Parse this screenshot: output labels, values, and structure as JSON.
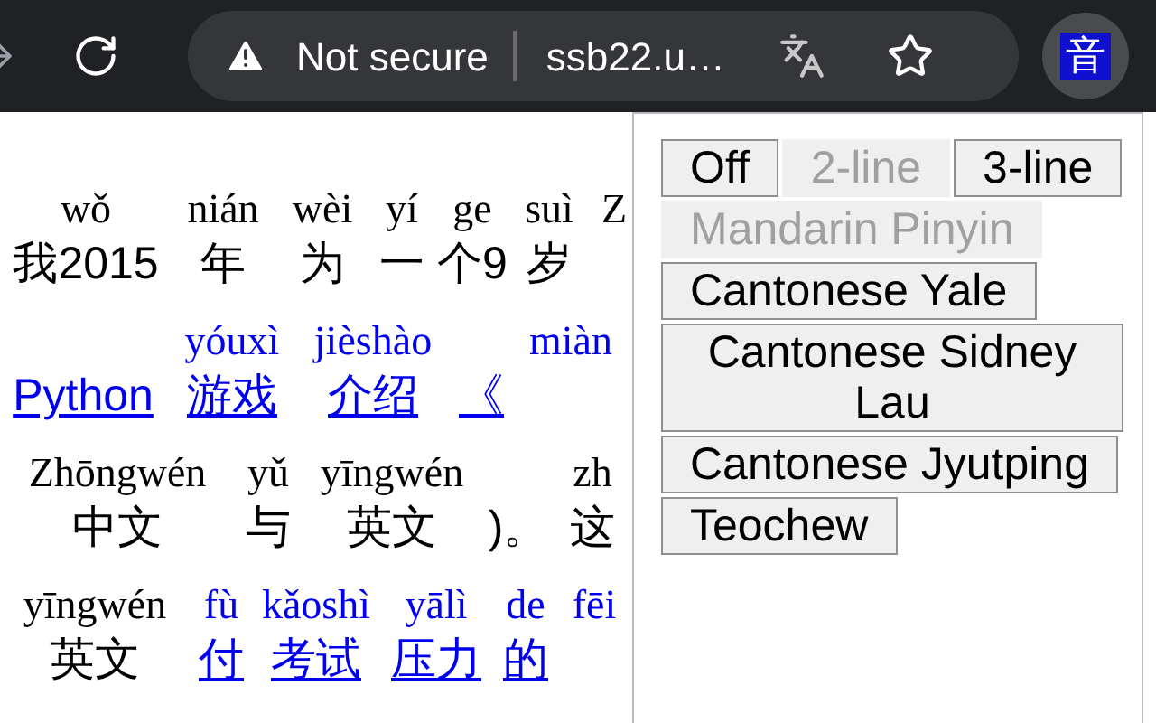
{
  "toolbar": {
    "security_label": "Not secure",
    "url": "ssb22.u…",
    "extension_label": "音"
  },
  "page": {
    "rows": [
      {
        "segments": [
          {
            "pinyin": "wǒ",
            "hanzi": "我2015",
            "link": false
          },
          {
            "pinyin": "nián",
            "hanzi": "年",
            "link": false
          },
          {
            "pinyin": "wèi",
            "hanzi": "为",
            "link": false
          },
          {
            "pinyin": "yí",
            "hanzi": "一",
            "link": false
          },
          {
            "pinyin": "ge",
            "hanzi": "个9",
            "link": false
          },
          {
            "pinyin": "suì",
            "hanzi": "岁",
            "link": false
          },
          {
            "pinyin": "Z",
            "link": false
          }
        ]
      },
      {
        "segments": [
          {
            "hanzi": "Python",
            "link": true
          },
          {
            "pinyin": "yóuxì",
            "hanzi": "游戏",
            "link": true
          },
          {
            "pinyin": "jièshào",
            "hanzi": "介绍",
            "link": true
          },
          {
            "hanzi": "《",
            "link": true
          },
          {
            "pinyin": "miàn",
            "link": true
          }
        ]
      },
      {
        "segments": [
          {
            "pinyin": "Zhōngwén",
            "hanzi": "中文",
            "link": false
          },
          {
            "pinyin": "yǔ",
            "hanzi": "与",
            "link": false
          },
          {
            "pinyin": "yīngwén",
            "hanzi": "英文",
            "link": false
          },
          {
            "hanzi": ")。",
            "link": false
          },
          {
            "pinyin": "zh",
            "hanzi": "这",
            "link": false
          }
        ]
      },
      {
        "segments": [
          {
            "pinyin": "yīngwén",
            "hanzi": "英文",
            "link": false
          },
          {
            "pinyin": "fù",
            "hanzi": "付",
            "link": true
          },
          {
            "pinyin": "kǎoshì",
            "hanzi": "考试",
            "link": true
          },
          {
            "pinyin": "yālì",
            "hanzi": "压力",
            "link": true
          },
          {
            "pinyin": "de",
            "hanzi": "的",
            "link": true
          },
          {
            "pinyin": "fēi",
            "link": true
          }
        ]
      }
    ]
  },
  "popup": {
    "buttons": [
      {
        "label": "Off",
        "disabled": false
      },
      {
        "label": "2-line",
        "disabled": true
      },
      {
        "label": "3-line",
        "disabled": false
      },
      {
        "label": "Mandarin Pinyin",
        "disabled": true
      },
      {
        "label": "Cantonese Yale",
        "disabled": false
      },
      {
        "label": "Cantonese Sidney Lau",
        "disabled": false
      },
      {
        "label": "Cantonese Jyutping",
        "disabled": false
      },
      {
        "label": "Teochew",
        "disabled": false
      }
    ]
  }
}
